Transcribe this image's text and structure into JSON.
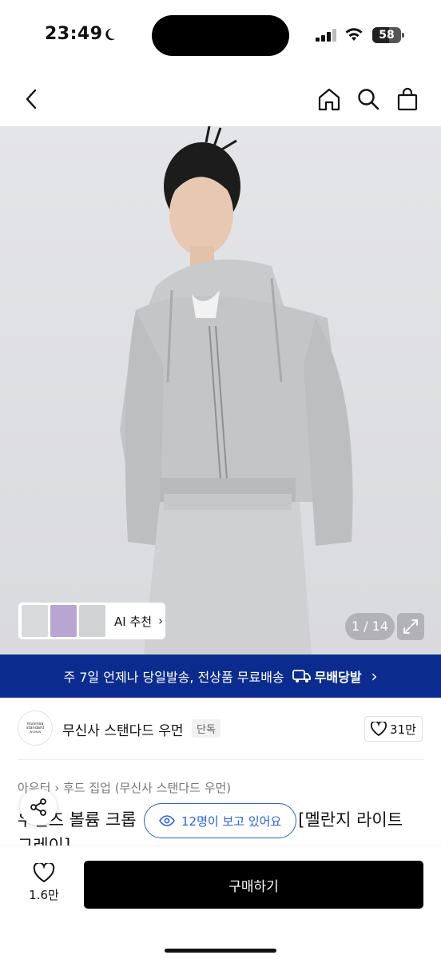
{
  "status": {
    "time": "23:49",
    "battery": "58"
  },
  "nav": {
    "back_icon": "chevron-left-icon",
    "home_icon": "home-icon",
    "search_icon": "search-icon",
    "bag_icon": "bag-icon"
  },
  "gallery": {
    "ai_label": "AI 추천",
    "counter": "1 / 14",
    "expand_icon": "expand-icon"
  },
  "promo": {
    "text": "주 7일 언제나 당일발송, 전상품 무료배송",
    "badge": "무배당발",
    "chevron": "›"
  },
  "brand": {
    "logo_line1": "musinsa",
    "logo_line2": "standard",
    "logo_line3": "WOMAN",
    "name": "무신사 스탠다드 우먼",
    "badge": "단독",
    "likes": "31만"
  },
  "product": {
    "breadcrumb_1": "아우터",
    "breadcrumb_2": "후드 집업 (무신사 스탠다드 우먼)",
    "title_start": "우먼즈 볼륨 크롭",
    "title_end": "[멜란지 라이트",
    "title_line2": "그레이]"
  },
  "viewers": {
    "text": "12명이 보고 있어요"
  },
  "bottom": {
    "wish_count": "1.6만",
    "buy_label": "구매하기"
  },
  "colors": {
    "promo_bg": "#0b2b8e",
    "accent_blue": "#2a62d8",
    "buy_bg": "#000000"
  }
}
